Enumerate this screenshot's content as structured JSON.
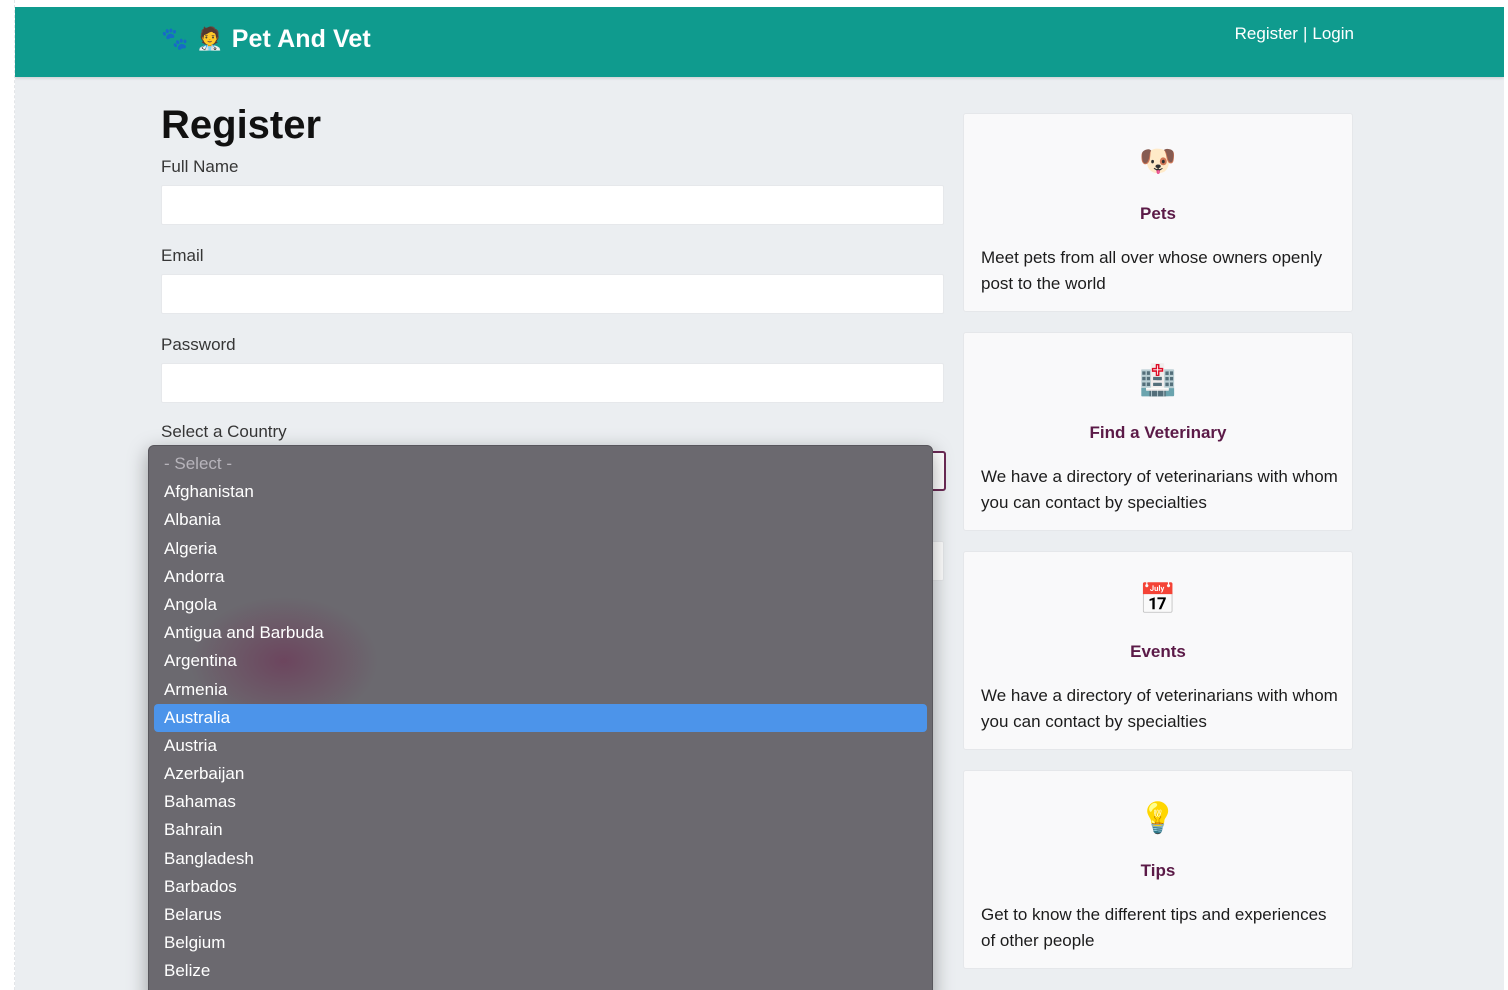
{
  "header": {
    "brand_icons": "🐾 🧑‍⚕️",
    "brand_title": "Pet And Vet",
    "nav_register": "Register",
    "nav_separator": "|",
    "nav_login": "Login",
    "brand_color": "#0f9b8e"
  },
  "form": {
    "title": "Register",
    "full_name_label": "Full Name",
    "email_label": "Email",
    "password_label": "Password",
    "country_label": "Select a Country"
  },
  "country_dropdown": {
    "selected": "Australia",
    "options": [
      "- Select -",
      "Afghanistan",
      "Albania",
      "Algeria",
      "Andorra",
      "Angola",
      "Antigua and Barbuda",
      "Argentina",
      "Armenia",
      "Australia",
      "Austria",
      "Azerbaijan",
      "Bahamas",
      "Bahrain",
      "Bangladesh",
      "Barbados",
      "Belarus",
      "Belgium",
      "Belize"
    ]
  },
  "cards": [
    {
      "icon": "dog-face-icon",
      "glyph": "🐶",
      "title": "Pets",
      "text": "Meet pets from all over whose owners openly post to the world"
    },
    {
      "icon": "hospital-icon",
      "glyph": "🏥",
      "title": "Find a Veterinary",
      "text": "We have a directory of veterinarians with whom you can contact by specialties"
    },
    {
      "icon": "calendar-icon",
      "glyph": "📅",
      "title": "Events",
      "text": "We have a directory of veterinarians with whom you can contact by specialties"
    },
    {
      "icon": "light-bulb-icon",
      "glyph": "💡",
      "title": "Tips",
      "text": "Get to know the different tips and experiences of other people"
    }
  ],
  "colors": {
    "card_title": "#5b1a47",
    "page_bg": "#ebeef1",
    "dropdown_bg": "#6b696f",
    "dropdown_highlight": "#4c94ea",
    "focus_border": "#6b2a55"
  }
}
